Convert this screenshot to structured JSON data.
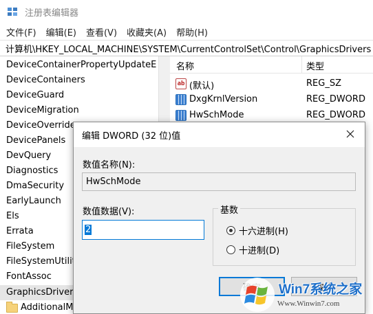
{
  "window": {
    "title": "注册表编辑器"
  },
  "menu": [
    "文件(F)",
    "编辑(E)",
    "查看(V)",
    "收藏夹(A)",
    "帮助(H)"
  ],
  "address": "计算机\\HKEY_LOCAL_MACHINE\\SYSTEM\\CurrentControlSet\\Control\\GraphicsDrivers",
  "tree": {
    "items": [
      "DeviceContainerPropertyUpdateE",
      "DeviceContainers",
      "DeviceGuard",
      "DeviceMigration",
      "DeviceOverrides",
      "DevicePanels",
      "DevQuery",
      "Diagnostics",
      "DmaSecurity",
      "EarlyLaunch",
      "Els",
      "Errata",
      "FileSystem",
      "FileSystemUtiliti",
      "FontAssoc",
      "GraphicsDrivers"
    ],
    "selected_index": 15,
    "child": "AdditionalMo"
  },
  "values": {
    "header": {
      "name": "名称",
      "type": "类型"
    },
    "rows": [
      {
        "icon": "string-value-icon",
        "name": "(默认)",
        "type": "REG_SZ"
      },
      {
        "icon": "dword-value-icon",
        "name": "DxgKrnlVersion",
        "type": "REG_DWORD"
      },
      {
        "icon": "dword-value-icon",
        "name": "HwSchMode",
        "type": "REG_DWORD"
      }
    ]
  },
  "dialog": {
    "title": "编辑 DWORD (32 位)值",
    "value_name_label": "数值名称(N):",
    "value_name": "HwSchMode",
    "value_data_label": "数值数据(V):",
    "value_data": "2",
    "base_label": "基数",
    "radio_hex": "十六进制(H)",
    "radio_dec": "十进制(D)",
    "selected_base": "hex",
    "ok_label": "确定",
    "cancel_label": "取消"
  },
  "watermark": {
    "brand": "Win7系统之家",
    "url": "Www.Winwin7.com"
  },
  "colors": {
    "accent": "#0078d7",
    "dialog_bg": "#f0f0f0",
    "brand": "#1e6fc9"
  }
}
